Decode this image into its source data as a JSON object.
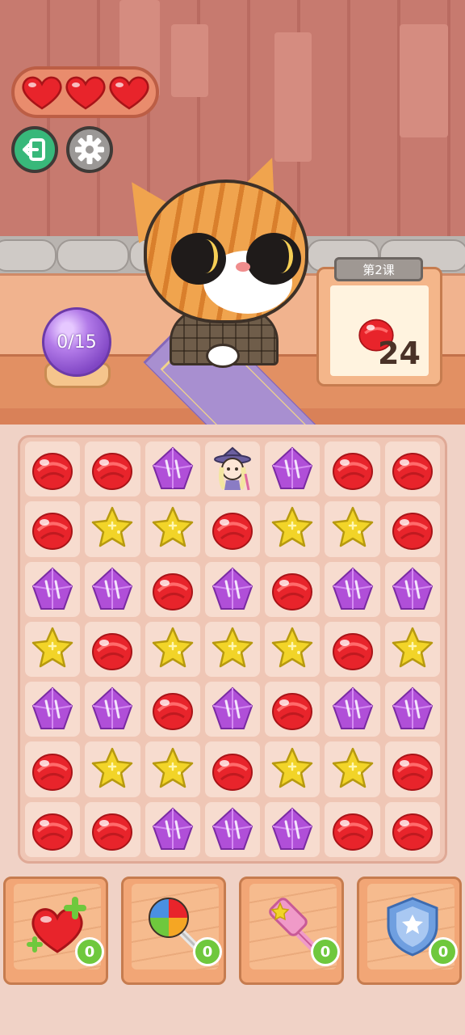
{
  "hud": {
    "lives": 3,
    "exit_icon": "exit-icon",
    "settings_icon": "gear-icon"
  },
  "orb": {
    "progress_text": "0/15"
  },
  "level": {
    "title": "第2课",
    "target_gem": "red",
    "target_count": "24"
  },
  "board": {
    "rows": [
      [
        "red",
        "red",
        "purple",
        "empty",
        "purple",
        "red",
        "red"
      ],
      [
        "red",
        "star",
        "star",
        "red",
        "star",
        "star",
        "red"
      ],
      [
        "purple",
        "purple",
        "red",
        "purple",
        "red",
        "purple",
        "purple"
      ],
      [
        "star",
        "red",
        "star",
        "star",
        "star",
        "red",
        "star"
      ],
      [
        "purple",
        "purple",
        "red",
        "purple",
        "red",
        "purple",
        "purple"
      ],
      [
        "red",
        "star",
        "star",
        "red",
        "star",
        "star",
        "red"
      ],
      [
        "red",
        "red",
        "purple",
        "purple",
        "purple",
        "red",
        "red"
      ]
    ],
    "character_icon": "witch-character"
  },
  "boosters": [
    {
      "name": "extra-heart",
      "icon": "heart-plus-icon",
      "count": "0"
    },
    {
      "name": "rainbow-lollipop",
      "icon": "lollipop-icon",
      "count": "0"
    },
    {
      "name": "hammer",
      "icon": "hammer-icon",
      "count": "0"
    },
    {
      "name": "shield",
      "icon": "shield-icon",
      "count": "0"
    }
  ],
  "colors": {
    "red_gem": "#e8242b",
    "purple_gem": "#b04fd8",
    "star_gem": "#f2d428",
    "badge": "#6fc83d"
  }
}
